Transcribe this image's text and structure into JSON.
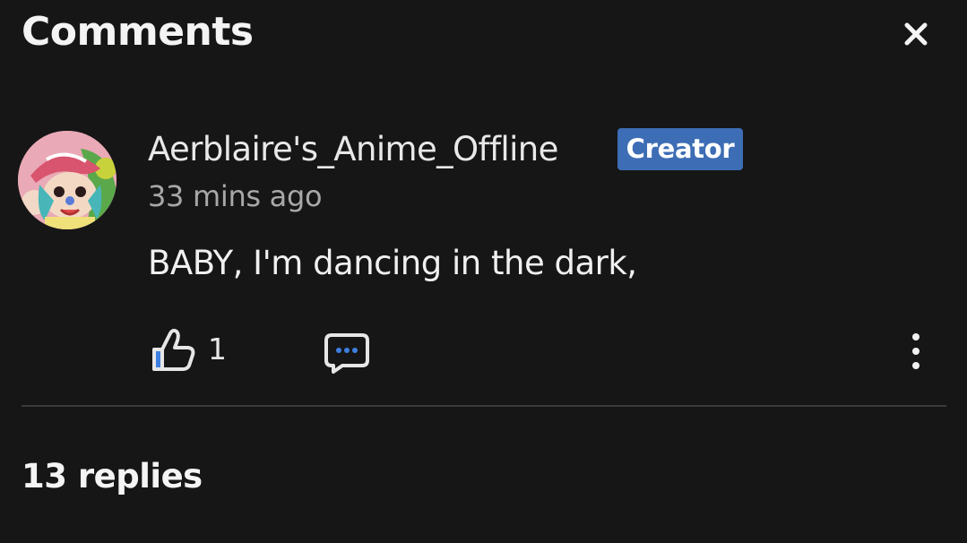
{
  "header": {
    "title": "Comments",
    "close_icon": "close-icon"
  },
  "comment": {
    "username": "Aerblaire's_Anime_Offline",
    "badge": "Creator",
    "timestamp": "33 mins ago",
    "text": "BABY, I'm dancing in the dark,",
    "likes": "1",
    "like_icon": "thumbs-up-icon",
    "reply_icon": "chat-bubble-icon",
    "more_icon": "more-vertical-icon"
  },
  "replies": {
    "title": "13 replies"
  },
  "colors": {
    "background": "#161616",
    "badge": "#3d6db5",
    "accent_blue": "#3d7fe0",
    "divider": "#3a3a3a"
  }
}
